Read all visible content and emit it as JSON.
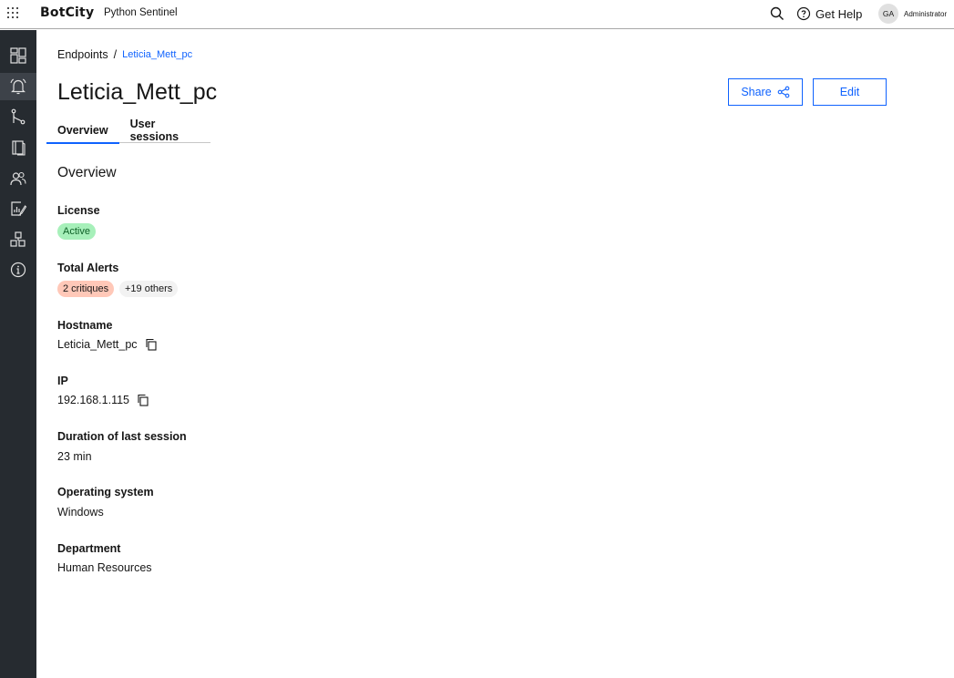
{
  "header": {
    "brand": "BotCity",
    "product": "Python Sentinel",
    "help_label": "Get Help",
    "user_initials": "GA",
    "user_role": "Administrator"
  },
  "sidebar": {
    "items": [
      {
        "icon": "dashboard-icon"
      },
      {
        "icon": "alerts-icon",
        "active": true
      },
      {
        "icon": "workflow-icon"
      },
      {
        "icon": "library-icon"
      },
      {
        "icon": "users-icon"
      },
      {
        "icon": "report-icon"
      },
      {
        "icon": "apps-icon"
      },
      {
        "icon": "info-icon"
      }
    ]
  },
  "breadcrumb": {
    "root": "Endpoints",
    "separator": "/",
    "current": "Leticia_Mett_pc"
  },
  "page": {
    "title": "Leticia_Mett_pc",
    "share_label": "Share",
    "edit_label": "Edit"
  },
  "tabs": [
    "Overview",
    "User sessions"
  ],
  "overview": {
    "title": "Overview",
    "license_label": "License",
    "license_status": "Active",
    "alerts_label": "Total Alerts",
    "alerts_critical": "2 critiques",
    "alerts_others": "+19 others",
    "hostname_label": "Hostname",
    "hostname_value": "Leticia_Mett_pc",
    "ip_label": "IP",
    "ip_value": "192.168.1.115",
    "duration_label": "Duration of last session",
    "duration_value": "23 min",
    "os_label": "Operating system",
    "os_value": "Windows",
    "department_label": "Department",
    "department_value": "Human Resources"
  },
  "colors": {
    "accent": "#0f62fe",
    "rail": "#262b30",
    "rail_active": "#3d4249",
    "tag_active_bg": "#a7f0ba",
    "tag_critical_bg": "#ffc8b8"
  }
}
